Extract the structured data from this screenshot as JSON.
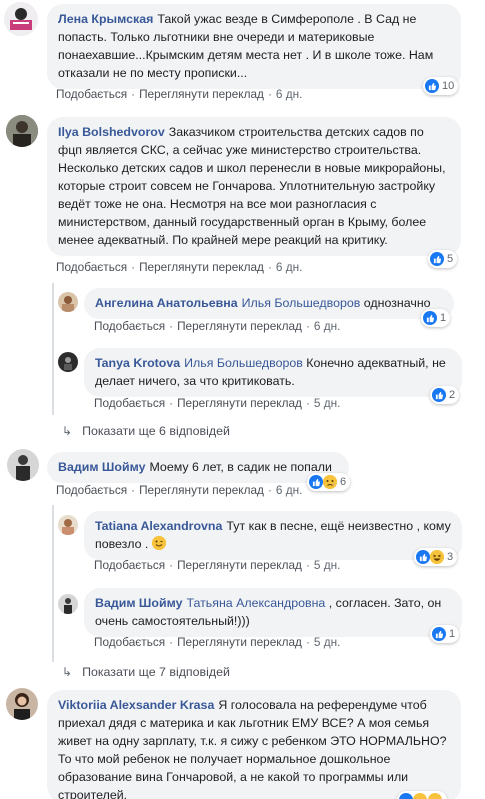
{
  "actions": {
    "like": "Подобається",
    "translate": "Переглянути переклад",
    "sep": "·"
  },
  "comments": [
    {
      "author": "Лена Крымская",
      "text": "Такой ужас везде в Симферополе . В Сад не попасть. Только льготники вне очереди и материковые понаехавшие...Крымским детям места нет . И в школе тоже. Нам отказали не по месту прописки...",
      "time": "6 дн.",
      "reactions": "10"
    },
    {
      "author": "Ilya Bolshedvorov",
      "text": "Заказчиком строительства детских садов по фцп является СКС, а сейчас уже министерство строительства. Несколько детских садов и школ перенесли в новые микрорайоны, которые строит совсем не Гончарова. Уплотнительную застройку ведёт тоже не она. Несмотря на все мои разногласия с министерством, данный государственный орган в Крыму, более менее адекватный. По крайней мере реакций на критику.",
      "time": "6 дн.",
      "reactions": "5"
    },
    {
      "author": "Ангелина Анатольевна",
      "mention": "Илья Большедворов",
      "text": "однозначно",
      "time": "6 дн.",
      "reactions": "1"
    },
    {
      "author": "Tanya Krotova",
      "mention": "Илья Большедворов",
      "text": "Конечно адекватный, не делает ничего, за что критиковать.",
      "time": "5 дн.",
      "reactions": "2"
    },
    {
      "author": "Вадим Шойму",
      "text": "Моему 6 лет, в садик не попали",
      "time": "6 дн.",
      "reactions": "6"
    },
    {
      "author": "Tatiana Alexandrovna",
      "text": "Тут как в песне, ещё неизвестно , кому повезло .",
      "time": "5 дн.",
      "reactions": "3"
    },
    {
      "author": "Вадим Шойму",
      "mention": "Татьяна Александровна",
      "text": ", согласен. Зато, он очень самостоятельный!)))",
      "time": "5 дн.",
      "reactions": "1"
    },
    {
      "author": "Viktoriia Alexsander Krasa",
      "text": "Я голосовала на референдуме чтоб приехал дядя с материка и как льготник ЕМУ ВСЕ? А моя семья живет на одну зарплату, т.к. я сижу с ребенком ЭТО НОРМАЛЬНО? То что мой ребенок не получает нормальное дошкольное образование вина Гончаровой, а не какой то программы или строителей."
    }
  ],
  "more_replies": [
    "Показати ще 6 відповідей",
    "Показати ще 7 відповідей"
  ],
  "colors": {
    "link": "#385898",
    "bubble": "#f2f3f5",
    "like": "#1877f2"
  }
}
